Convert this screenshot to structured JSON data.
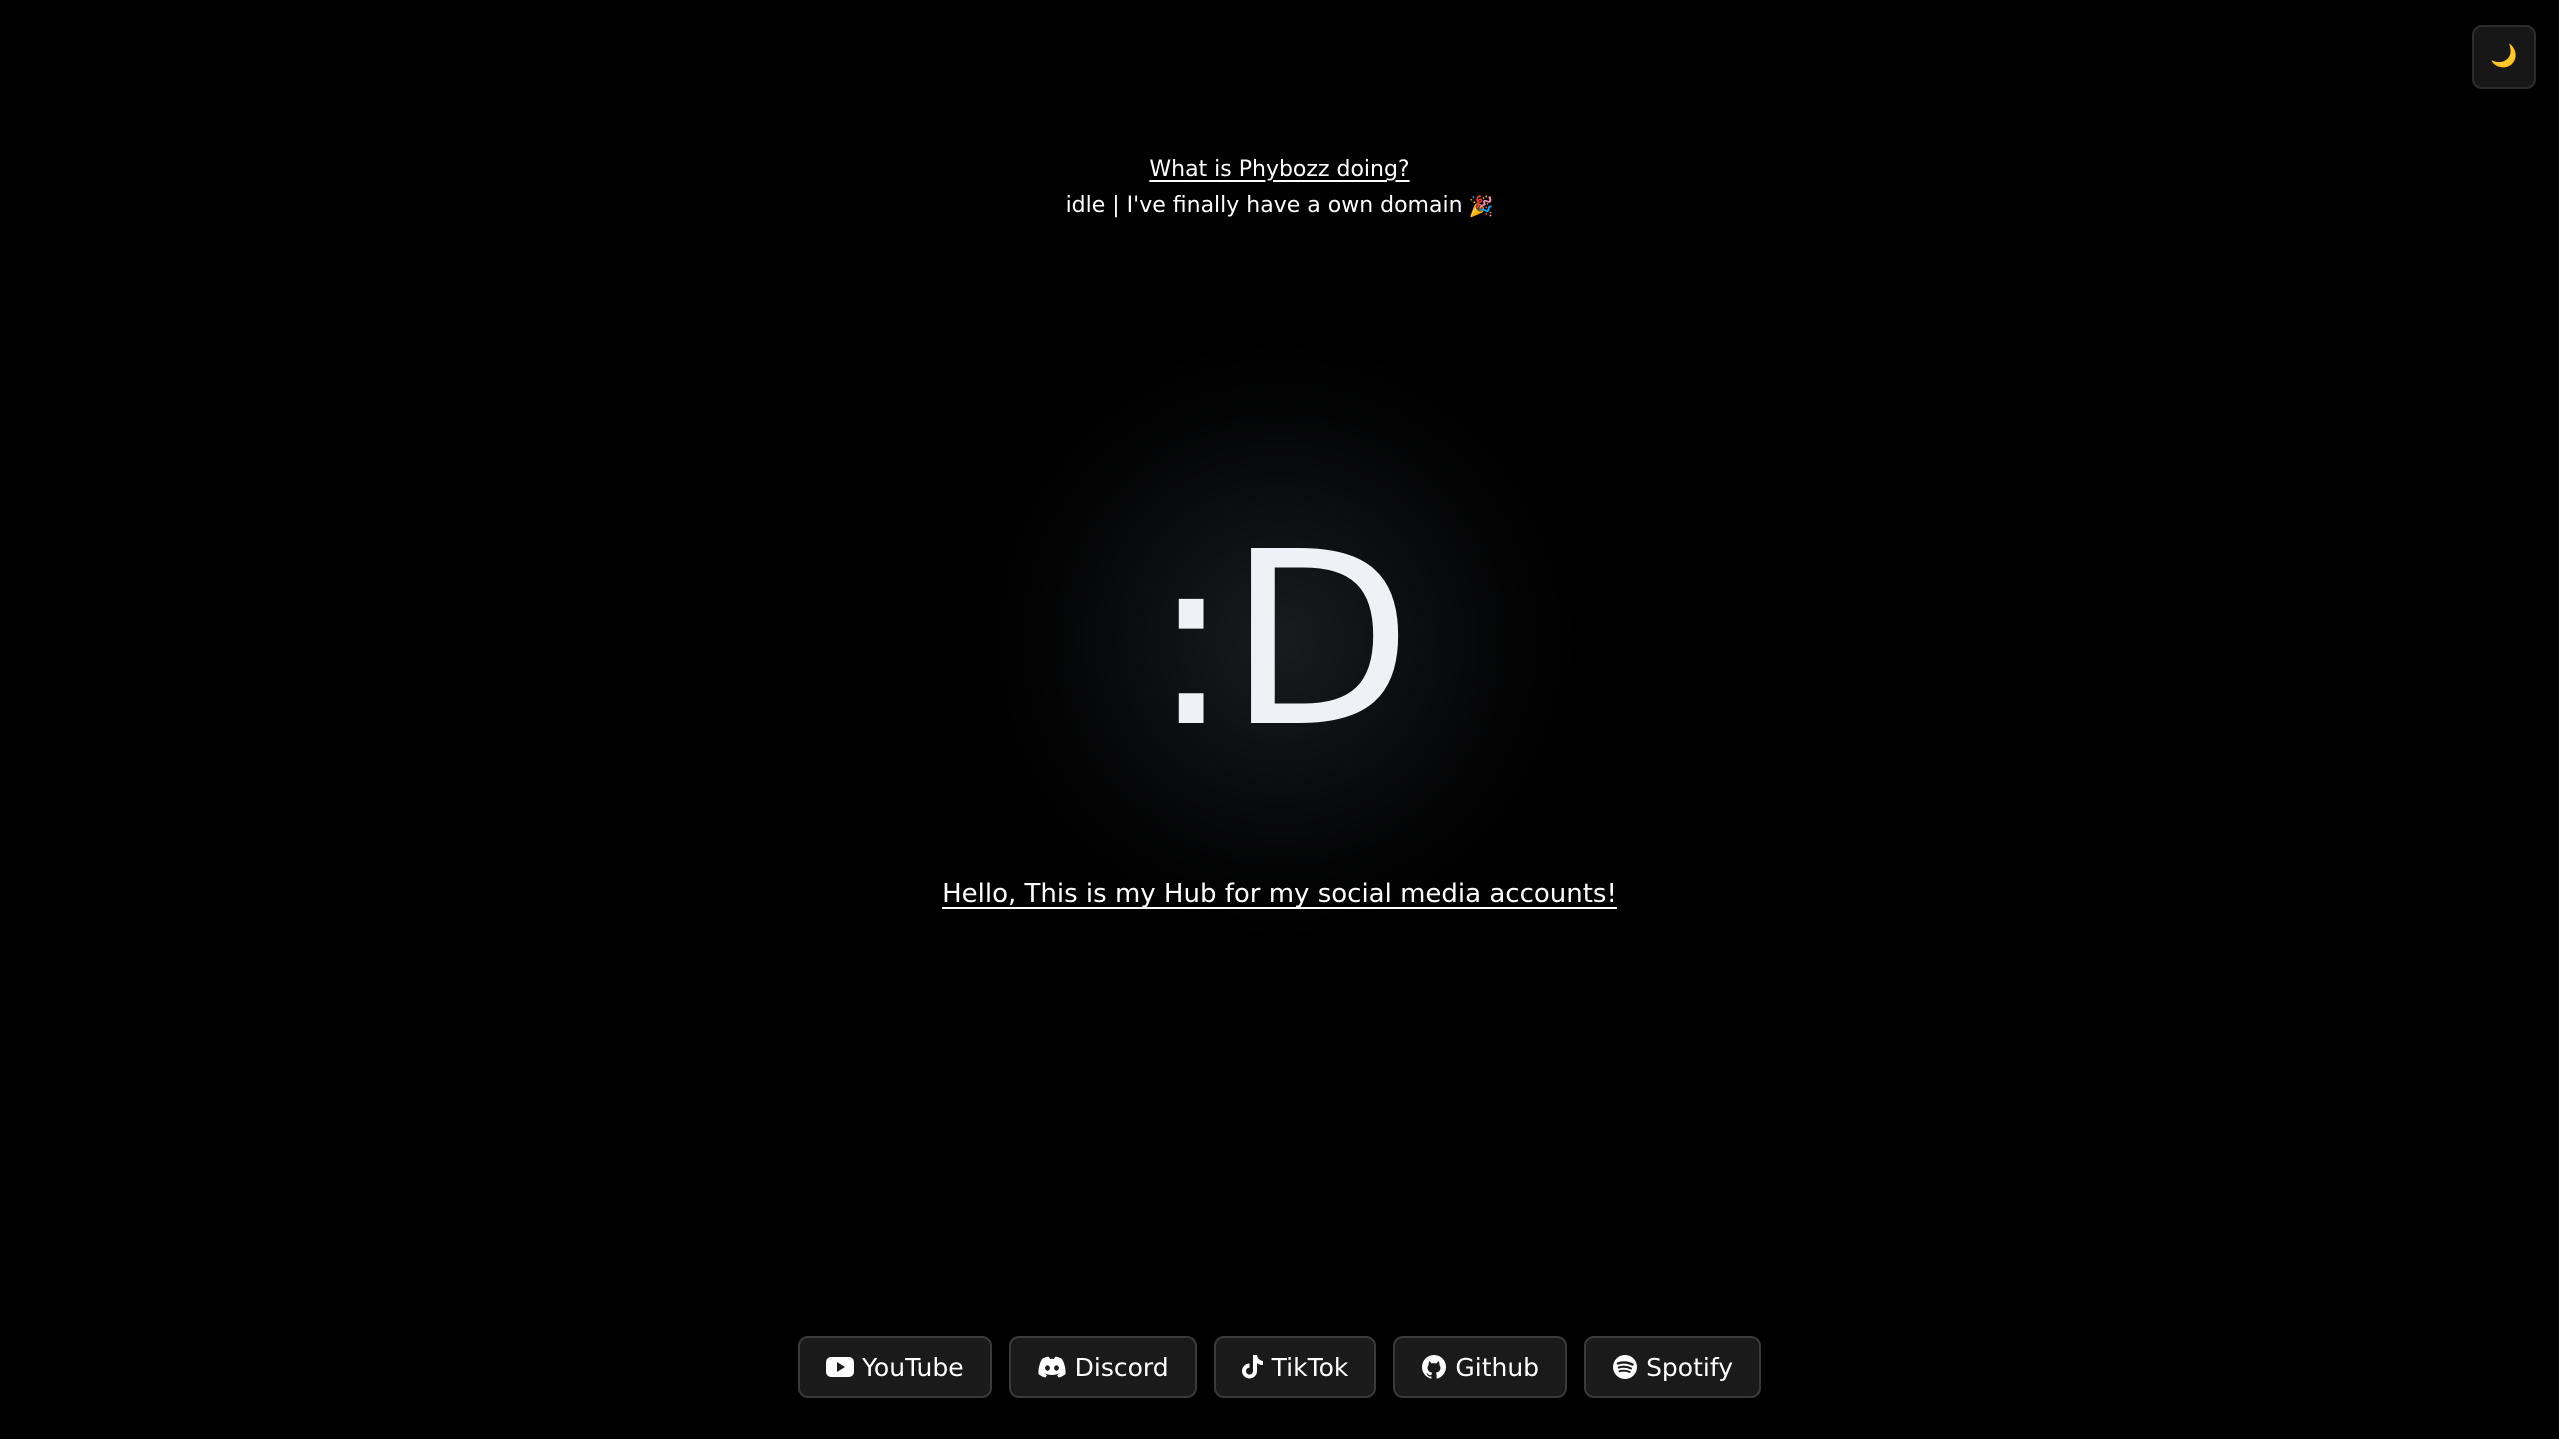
{
  "theme_toggle": {
    "icon": "moon-icon",
    "glyph": "🌙"
  },
  "status": {
    "title": "What is Phybozz doing?",
    "text": "idle | I've finally have a own domain",
    "emoji": "🎉"
  },
  "hero": {
    "face": ":D"
  },
  "hub": {
    "text": "Hello, This is my Hub for my social media accounts!"
  },
  "links": [
    {
      "label": "YouTube",
      "icon": "youtube-icon"
    },
    {
      "label": "Discord",
      "icon": "discord-icon"
    },
    {
      "label": "TikTok",
      "icon": "tiktok-icon"
    },
    {
      "label": "Github",
      "icon": "github-icon"
    },
    {
      "label": "Spotify",
      "icon": "spotify-icon"
    }
  ],
  "colors": {
    "background": "#000000",
    "text": "#ffffff",
    "button_bg": "#1a1a1a",
    "button_border": "#3a3a3a"
  }
}
